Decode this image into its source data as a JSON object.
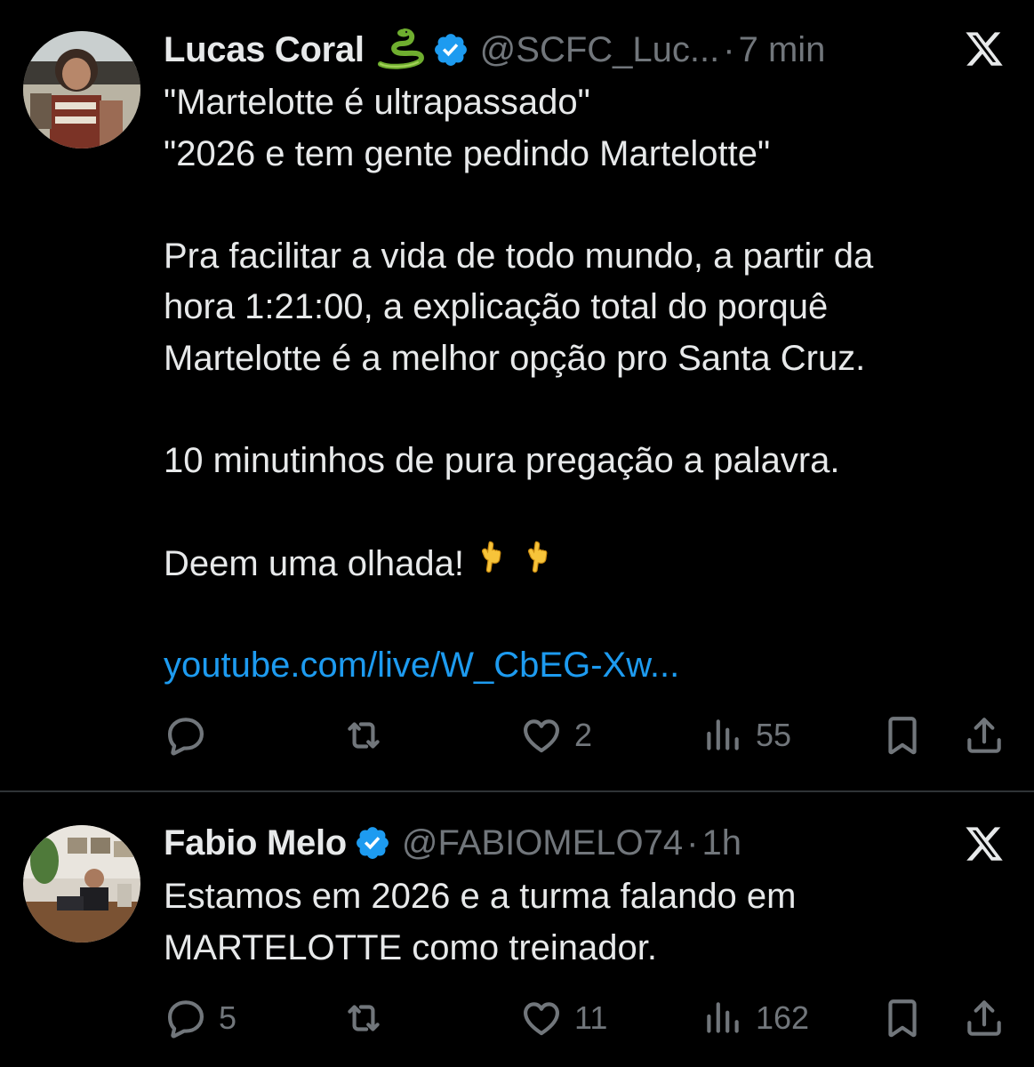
{
  "tweets": [
    {
      "name": "Lucas Coral",
      "handle": "@SCFC_Luc...",
      "dot": "·",
      "time": "7 min",
      "lines": [
        "\"Martelotte é ultrapassado\"",
        "\"2026 e tem gente pedindo Martelotte\"",
        "",
        "Pra facilitar a vida de todo mundo, a partir da",
        "hora 1:21:00, a explicação total do porquê",
        "Martelotte é a melhor opção pro Santa Cruz.",
        "",
        "10 minutinhos de pura pregação a palavra.",
        "",
        "Deem uma olhada!"
      ],
      "link": "youtube.com/live/W_CbEG-Xw...",
      "stats": {
        "replies": "",
        "retweets": "",
        "likes": "2",
        "views": "55"
      }
    },
    {
      "name": "Fabio Melo",
      "handle": "@FABIOMELO74",
      "dot": "·",
      "time": "1h",
      "lines": [
        "Estamos em 2026 e a turma falando em",
        "MARTELOTTE como treinador."
      ],
      "stats": {
        "replies": "5",
        "retweets": "",
        "likes": "11",
        "views": "162"
      }
    }
  ],
  "icons": {
    "snake": "snake-emoji-icon",
    "verified": "verified-badge-icon",
    "hand": "backhand-index-pointing-down-icon",
    "x": "x-logo-icon"
  },
  "colors": {
    "background": "#000000",
    "text": "#e7e9ea",
    "muted": "#71767b",
    "link": "#1d9bf0",
    "verified": "#1d9bf0"
  }
}
